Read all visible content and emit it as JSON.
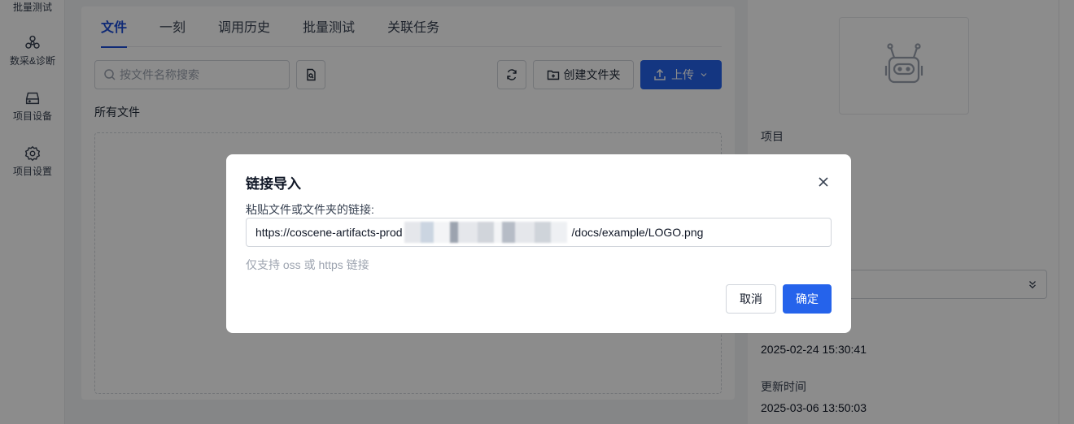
{
  "leftnav": {
    "items": [
      {
        "label": "批量测试",
        "icon": "batch-test-icon"
      },
      {
        "label": "数采&诊断",
        "icon": "biohazard-icon"
      },
      {
        "label": "项目设备",
        "icon": "device-icon"
      },
      {
        "label": "项目设置",
        "icon": "gear-icon"
      }
    ]
  },
  "main": {
    "tabs": [
      {
        "label": "文件",
        "active": true
      },
      {
        "label": "一刻",
        "active": false
      },
      {
        "label": "调用历史",
        "active": false
      },
      {
        "label": "批量测试",
        "active": false
      },
      {
        "label": "关联任务",
        "active": false
      }
    ],
    "search_placeholder": "按文件名称搜索",
    "create_folder_label": "创建文件夹",
    "upload_label": "上传",
    "all_files_label": "所有文件"
  },
  "rightpanel": {
    "project_label": "项目",
    "created_time": "2025-02-24 15:30:41",
    "updated_label": "更新时间",
    "updated_time": "2025-03-06 13:50:03"
  },
  "modal": {
    "title": "链接导入",
    "field_label": "粘贴文件或文件夹的链接:",
    "url_prefix": "https://coscene-artifacts-prod",
    "url_suffix": "/docs/example/LOGO.png",
    "hint": "仅支持 oss 或 https 链接",
    "cancel_label": "取消",
    "confirm_label": "确定"
  },
  "colors": {
    "primary": "#2563eb",
    "overlay": "rgba(0,0,0,0.45)"
  }
}
